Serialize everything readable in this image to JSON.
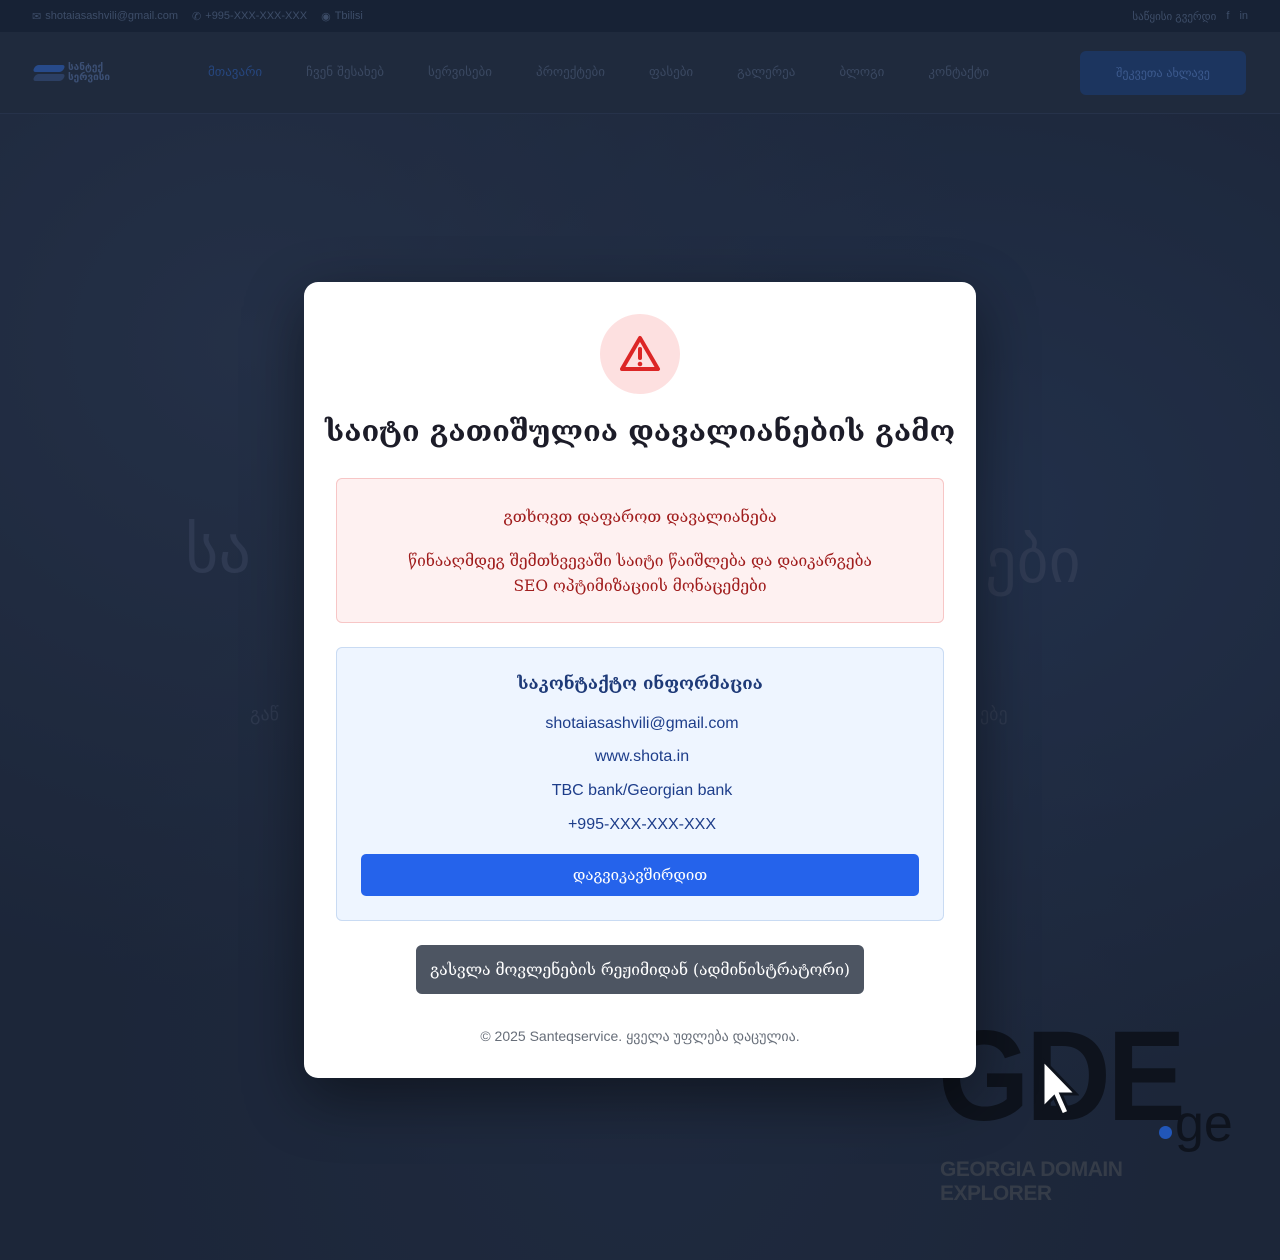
{
  "background": {
    "topbar": {
      "email": "shotaiasashvili@gmail.com",
      "phone": "+995-XXX-XXX-XXX",
      "location": "Tbilisi",
      "right_text": "საწყისი გვერდი"
    },
    "navbar": {
      "logo_line1": "სანტექ",
      "logo_line2": "სერვისი",
      "links": [
        "მთავარი",
        "ჩვენ შესახებ",
        "სერვისები",
        "პროექტები",
        "ფასები",
        "გალერეა",
        "ბლოგი",
        "კონტაქტი"
      ],
      "cta_label": "შეკვეთა ახლავე"
    },
    "hero": {
      "title_left": "სა",
      "title_right": "ები",
      "sub_left": "გაწ",
      "sub_right": "ებე"
    }
  },
  "modal": {
    "title": "საიტი გათიშულია დავალიანების გამო",
    "icon": "warning-triangle-icon",
    "debt": {
      "title": "გთხოვთ დაფაროთ დავალიანება",
      "text": "წინააღმდეგ შემთხვევაში საიტი წაიშლება და დაიკარგება SEO ოპტიმიზაციის მონაცემები"
    },
    "contact": {
      "title": "საკონტაქტო ინფორმაცია",
      "email": "shotaiasashvili@gmail.com",
      "website": "www.shota.in",
      "bank": "TBC bank/Georgian bank",
      "phone": "+995-XXX-XXX-XXX",
      "icon_glyph": "",
      "button_label": "დაგვიკავშირდით"
    },
    "exit_button_label": "გასვლა მოვლენების რეჟიმიდან (ადმინისტრატორი)",
    "copyright": "© 2025 Santeqservice. ყველა უფლება დაცულია."
  },
  "watermark": {
    "letters": "GDE",
    "tld": "ge",
    "subtitle": "GEORGIA DOMAIN EXPLORER"
  },
  "colors": {
    "accent": "#2563eb",
    "danger": "#a01d1d",
    "exit_button": "#4d5562"
  }
}
